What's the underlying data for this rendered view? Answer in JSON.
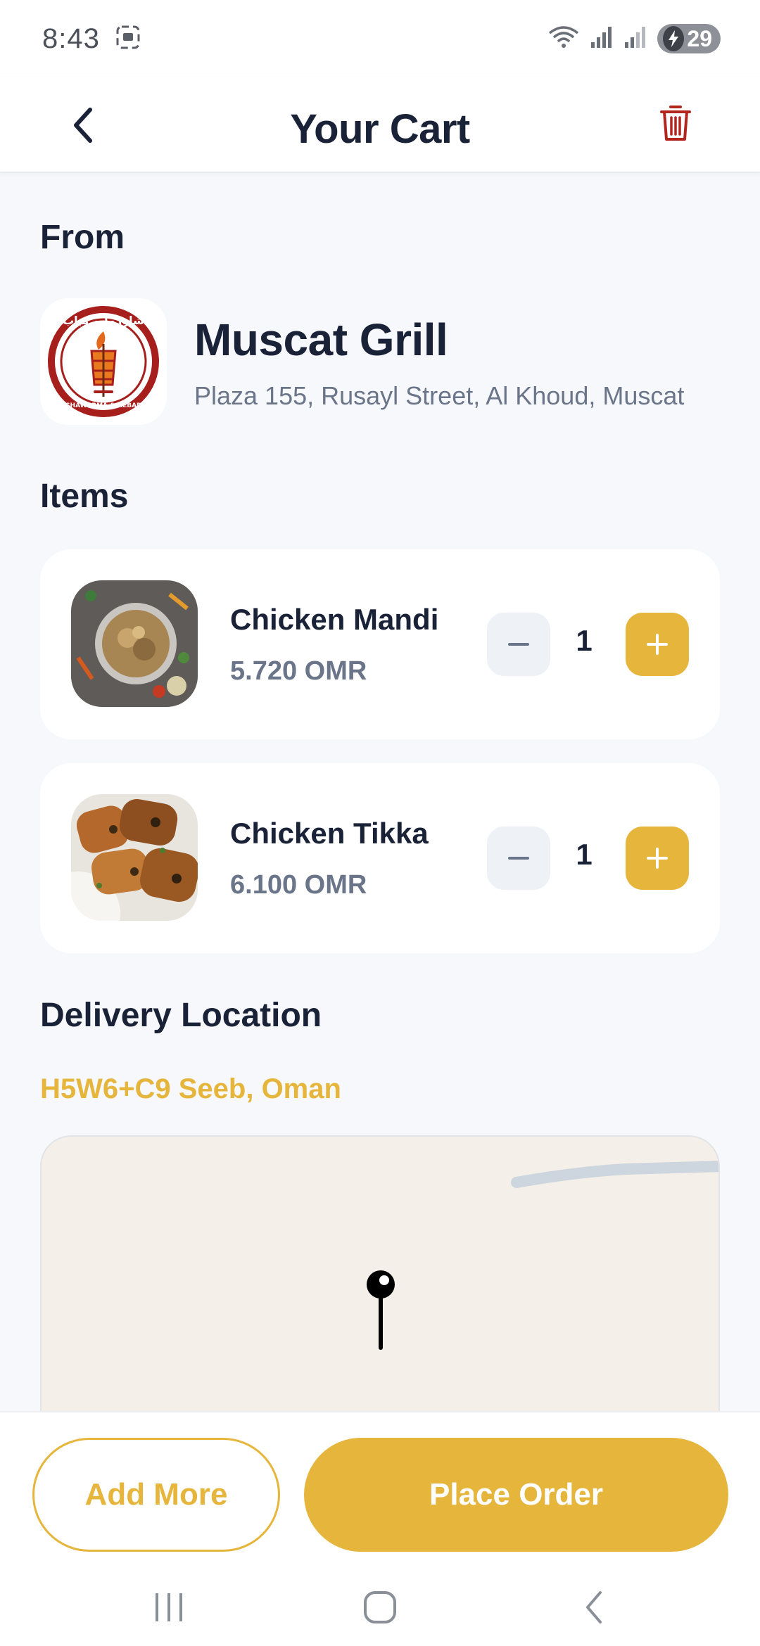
{
  "status_bar": {
    "time": "8:43",
    "battery": "29",
    "icons": [
      "screenshot-icon",
      "wifi-icon",
      "signal-icon",
      "signal-icon",
      "charging-icon"
    ]
  },
  "header": {
    "title": "Your Cart",
    "back_icon": "chevron-left-icon",
    "clear_icon": "trash-icon"
  },
  "from": {
    "section_label": "From",
    "restaurant_name": "Muscat Grill",
    "restaurant_address": "Plaza 155, Rusayl Street, Al Khoud, Muscat",
    "logo": {
      "arabic_text": "شاورما و كباب",
      "english_text": "SHAWARMA & KEBAB"
    }
  },
  "items": {
    "section_label": "Items",
    "list": [
      {
        "name": "Chicken Mandi",
        "price": "5.720 OMR",
        "quantity": "1"
      },
      {
        "name": "Chicken Tikka",
        "price": "6.100 OMR",
        "quantity": "1"
      }
    ]
  },
  "delivery": {
    "section_label": "Delivery Location",
    "address": "H5W6+C9 Seeb, Oman"
  },
  "actions": {
    "add_more": "Add More",
    "place_order": "Place Order"
  },
  "colors": {
    "accent": "#e6b53c",
    "danger": "#b3261e",
    "text_primary": "#1a2238",
    "text_secondary": "#6b7589",
    "background": "#f6f8fb"
  }
}
